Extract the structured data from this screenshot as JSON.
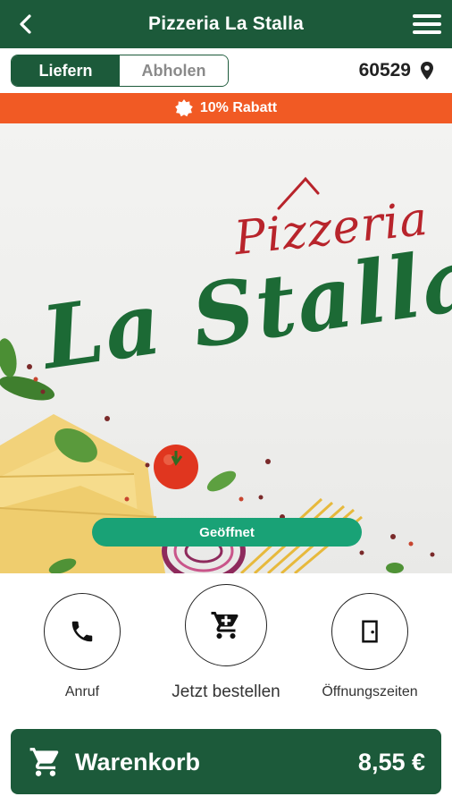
{
  "header": {
    "title": "Pizzeria La Stalla"
  },
  "mode_toggle": {
    "options": [
      "Liefern",
      "Abholen"
    ],
    "selected": "Liefern"
  },
  "location": {
    "zip": "60529"
  },
  "promo": {
    "text": "10% Rabatt"
  },
  "hero": {
    "brand_small": "Pizzeria",
    "brand_big": "La Stalla",
    "status": "Geöffnet"
  },
  "actions": [
    {
      "label": "Anruf",
      "icon": "phone-icon"
    },
    {
      "label": "Jetzt bestellen",
      "icon": "cart-icon"
    },
    {
      "label": "Öffnungszeiten",
      "icon": "door-icon"
    }
  ],
  "cart": {
    "label": "Warenkorb",
    "total": "8,55 €"
  },
  "colors": {
    "primary": "#1c5a3a",
    "promo": "#f15a24",
    "status": "#19a276",
    "brand_red": "#b8242b",
    "brand_green": "#1c6a35"
  }
}
